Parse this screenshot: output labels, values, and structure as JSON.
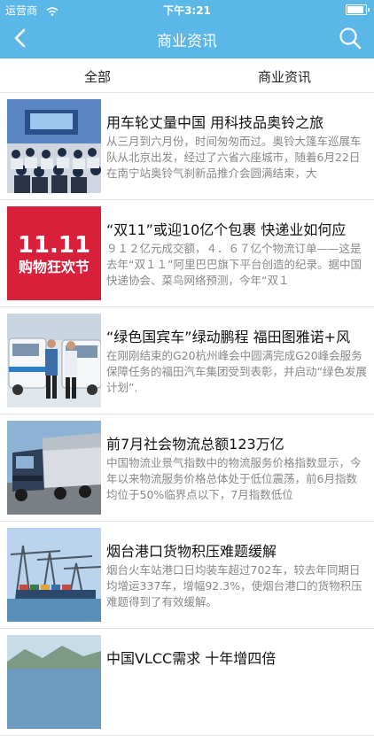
{
  "status": {
    "carrier": "运营商",
    "time": "下午3:21"
  },
  "nav": {
    "title": "商业资讯"
  },
  "tabs": [
    "全部",
    "商业资讯"
  ],
  "articles": [
    {
      "title": "用车轮丈量中国 用科技品奥铃之旅",
      "summary": "从三月到六月份，时间匆匆而过。奥铃大篷车巡展车队从北京出发，经过了六省六座城市，随着6月22日在南宁站奥铃气刹新品推介会圆满结束，大"
    },
    {
      "title": "“双11”或迎10亿个包裹 快递业如何应",
      "summary": "９１２亿元成交额，４．６７亿个物流订单——这是去年“双１１”阿里巴巴旗下平台创造的纪录。据中国快递协会、菜鸟网络预测，今年“双１"
    },
    {
      "title": "“绿色国宾车”绿动鹏程 福田图雅诺+风",
      "summary": "在刚刚结束的G20杭州峰会中圆满完成G20峰会服务保障任务的福田汽车集团受到表彰，并启动“绿色发展计划”."
    },
    {
      "title": "前7月社会物流总额123万亿",
      "summary": "中国物流业景气指数中的物流服务价格指数显示，今年以来物流服务价格总体处于低位震荡，前6月指数均位于50%临界点以下，7月指数低位"
    },
    {
      "title": "烟台港口货物积压难题缓解",
      "summary": "烟台火车站港口日均装车超过702车，较去年同期日均增运337车，增幅92.3%，使烟台港口的货物积压难题得到了有效缓解。"
    },
    {
      "title": "中国VLCC需求 十年增四倍",
      "summary": ""
    }
  ],
  "thumb_text": {
    "double11": "11.11",
    "double11_sub": "购物狂欢节"
  },
  "colors": {
    "nav": "#5bb7e8"
  }
}
